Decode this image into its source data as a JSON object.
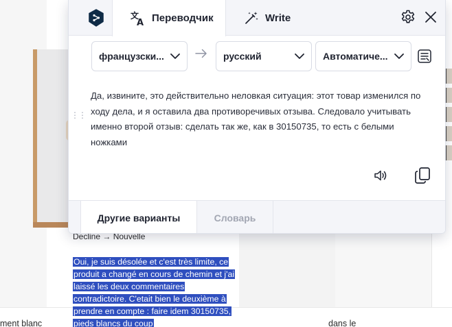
{
  "popup": {
    "tabs": {
      "translator": "Переводчик",
      "write": "Write"
    },
    "languages": {
      "source": "французски...",
      "target": "русский",
      "mode": "Автоматиче..."
    },
    "translation": "Да, извините, это действительно неловкая ситуация: этот товар изменился по ходу дела, и я оставила два противоречивых отзыва. Следовало учитывать именно второй отзыв: сделать так же, как в 30150735, то есть с белыми ножками",
    "footer": {
      "variants": "Другие варианты",
      "dictionary": "Словарь"
    },
    "icons": {
      "logo": "deepl-logo-icon",
      "translator": "translate-icon",
      "write": "magic-wand-icon",
      "settings": "gear-icon",
      "close": "close-icon",
      "swap": "arrow-right-icon",
      "glossary": "glossary-icon",
      "speaker": "speaker-icon",
      "copy": "copy-icon"
    },
    "colors": {
      "logo_bg": "#0f2b46",
      "accent_dark": "#1f2330",
      "disabled": "#a2a6b2",
      "panel_bg": "#f4f5f9"
    }
  },
  "background": {
    "decline_label": "Decline → Nouvelle",
    "selected_text": "Oui, je suis désolée et c'est très limite, ce produit a changé en cours de chemin et j'ai laissé les deux commentaires contradictoire. C'etait bien le deuxième à prendre en compte : faire idem 30150735, pieds blancs du coup",
    "bottom_left_text": "ment blanc",
    "bottom_right_text": "dans le",
    "selection_color": "#2f4fbf"
  }
}
